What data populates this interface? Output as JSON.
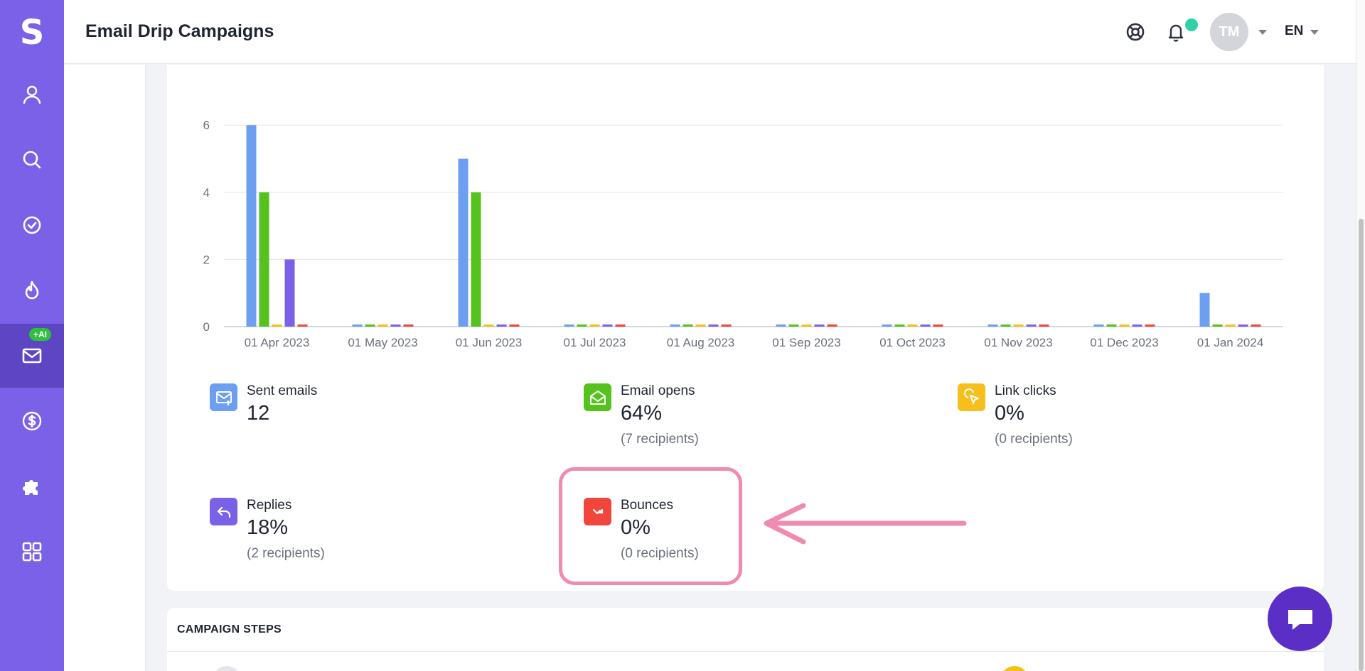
{
  "app": {
    "logo": "S",
    "page_title": "Email Drip Campaigns"
  },
  "sidebar": {
    "items": [
      {
        "name": "contacts",
        "icon": "person-icon"
      },
      {
        "name": "search",
        "icon": "search-icon"
      },
      {
        "name": "tasks",
        "icon": "check-circle-icon"
      },
      {
        "name": "deals",
        "icon": "flame-icon"
      },
      {
        "name": "email",
        "icon": "mail-icon",
        "badge": "+AI",
        "active": true
      },
      {
        "name": "billing",
        "icon": "dollar-circle-icon"
      },
      {
        "name": "integrations",
        "icon": "puzzle-icon"
      },
      {
        "name": "apps",
        "icon": "grid-icon"
      }
    ]
  },
  "header": {
    "avatar_initials": "TM",
    "language": "EN"
  },
  "chart_data": {
    "type": "bar",
    "categories": [
      "01 Apr 2023",
      "01 May 2023",
      "01 Jun 2023",
      "01 Jul 2023",
      "01 Aug 2023",
      "01 Sep 2023",
      "01 Oct 2023",
      "01 Nov 2023",
      "01 Dec 2023",
      "01 Jan 2024"
    ],
    "y_ticks": [
      "0",
      "2",
      "4",
      "6"
    ],
    "ylim": [
      0,
      6.6
    ],
    "grid": true,
    "legend": "none",
    "series": [
      {
        "color": "#6c9ff2",
        "values": [
          6,
          0,
          5,
          0,
          0,
          0,
          0,
          0,
          0,
          1
        ]
      },
      {
        "color": "#56c21e",
        "values": [
          4,
          0,
          4,
          0,
          0,
          0,
          0,
          0,
          0,
          0
        ]
      },
      {
        "color": "#f6bf1c",
        "values": [
          0,
          0,
          0,
          0,
          0,
          0,
          0,
          0,
          0,
          0
        ]
      },
      {
        "color": "#7b61e8",
        "values": [
          2,
          0,
          0,
          0,
          0,
          0,
          0,
          0,
          0,
          0
        ]
      },
      {
        "color": "#f0463c",
        "values": [
          0,
          0,
          0,
          0,
          0,
          0,
          0,
          0,
          0,
          0
        ]
      }
    ]
  },
  "stats": {
    "sent": {
      "label": "Sent emails",
      "value": "12",
      "color": "#6c9ff2",
      "icon": "mail-send-icon"
    },
    "opens": {
      "label": "Email opens",
      "value": "64%",
      "sub": "(7 recipients)",
      "color": "#56c21e",
      "icon": "mail-open-icon"
    },
    "clicks": {
      "label": "Link clicks",
      "value": "0%",
      "sub": "(0 recipients)",
      "color": "#f6bf1c",
      "icon": "cursor-click-icon"
    },
    "replies": {
      "label": "Replies",
      "value": "18%",
      "sub": "(2 recipients)",
      "color": "#7b61e8",
      "icon": "reply-icon"
    },
    "bounces": {
      "label": "Bounces",
      "value": "0%",
      "sub": "(0 recipients)",
      "color": "#f0463c",
      "icon": "bounce-icon"
    }
  },
  "annotation": {
    "highlight_color": "#f08aaf",
    "target": "bounces"
  },
  "campaign_steps": {
    "title": "CAMPAIGN STEPS"
  }
}
